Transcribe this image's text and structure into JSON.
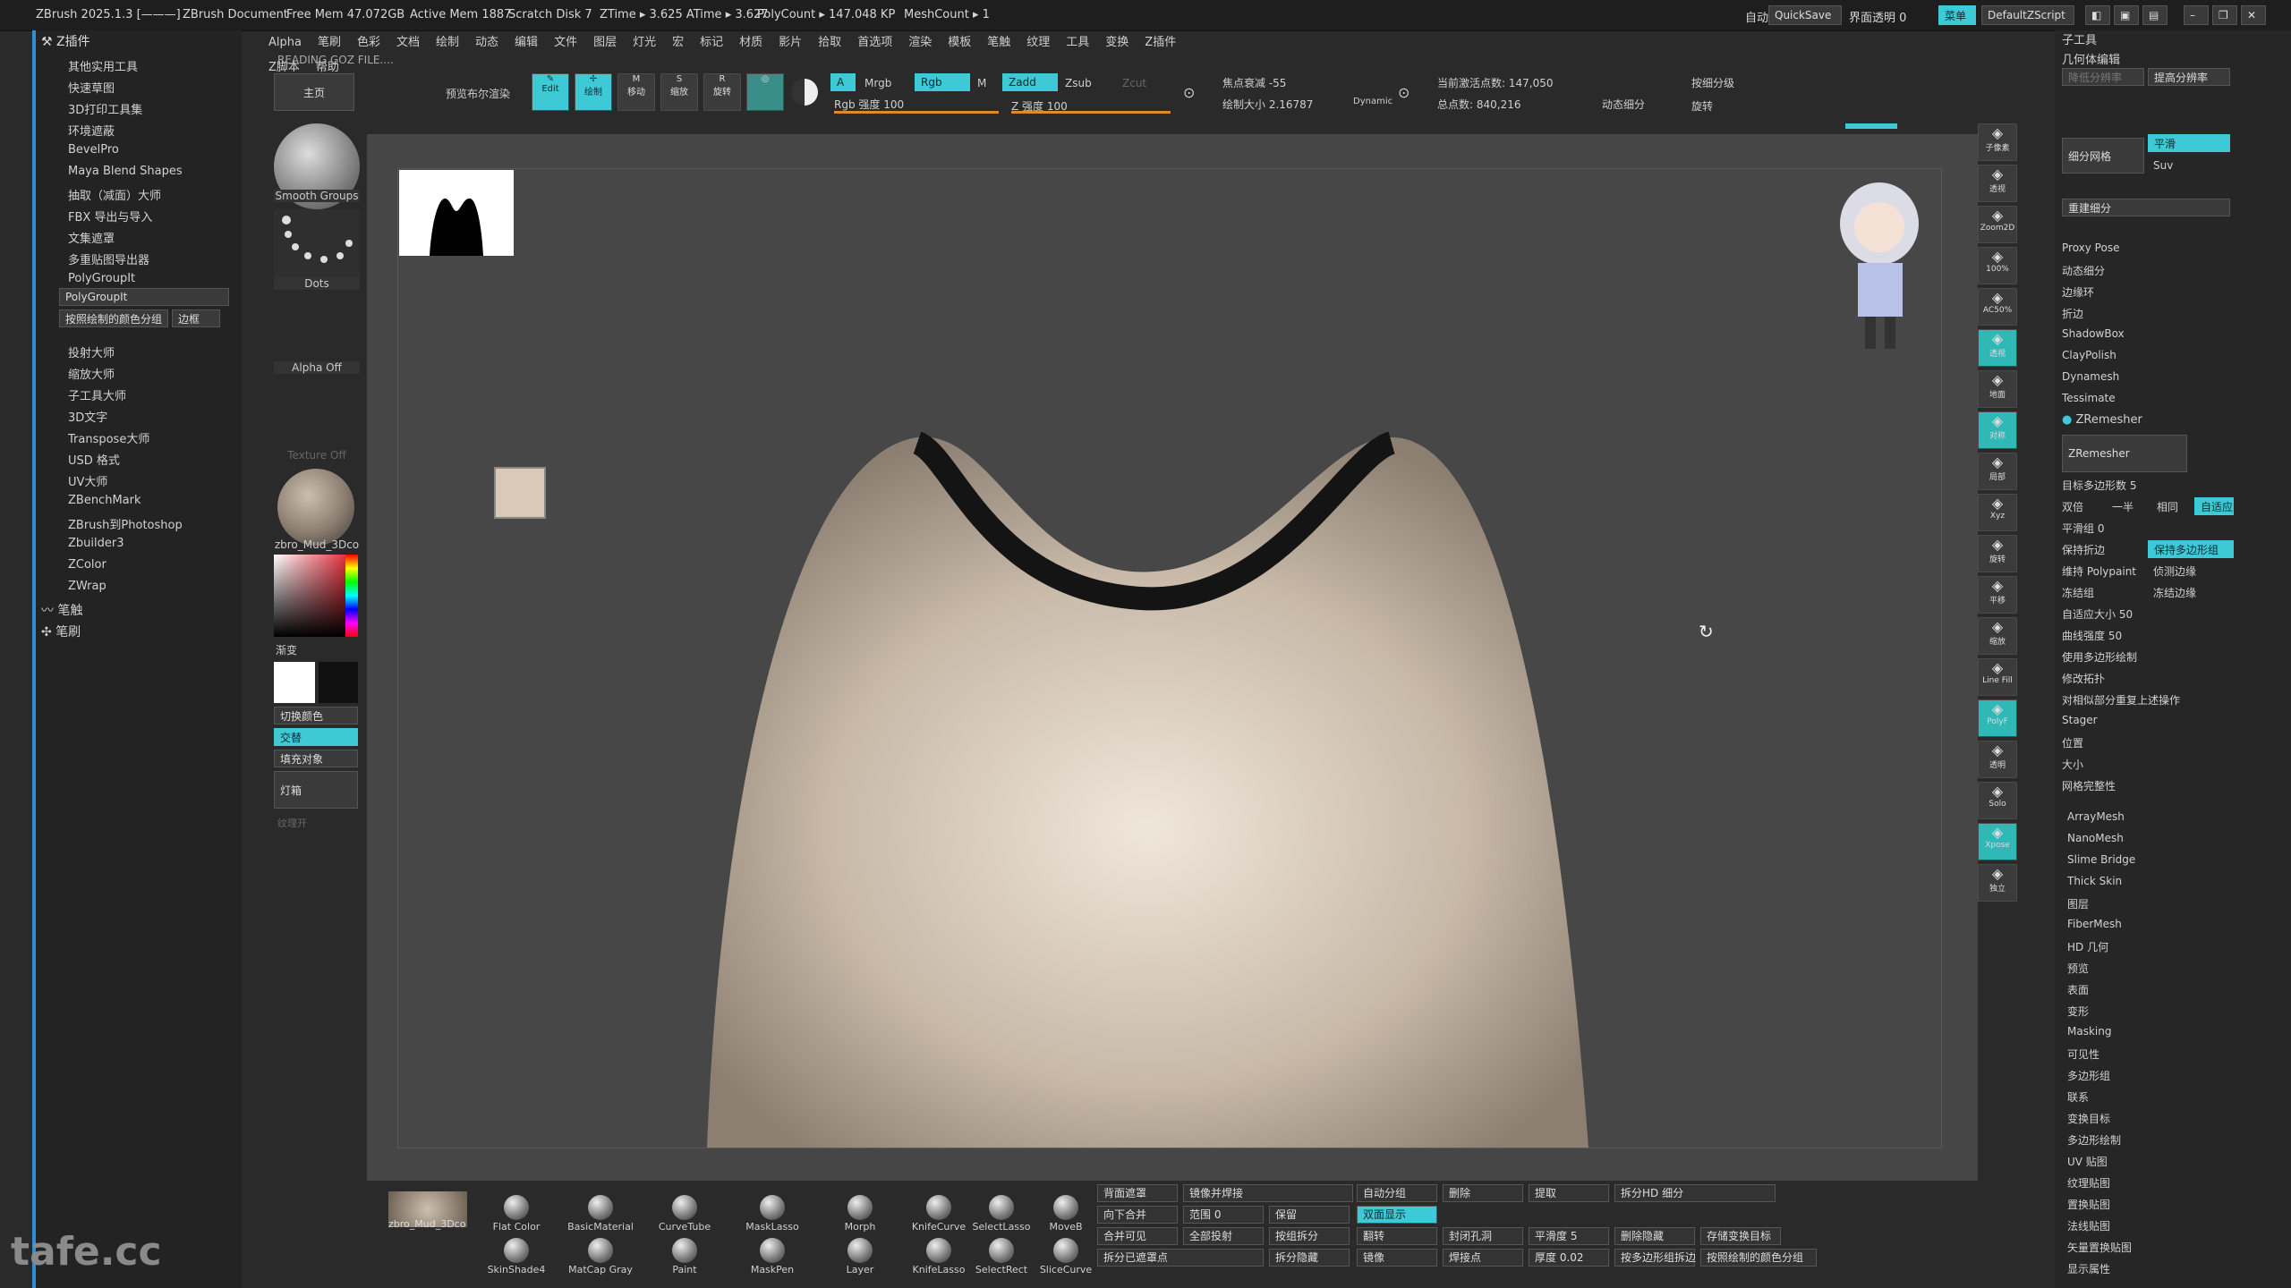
{
  "titlebar": {
    "app": "ZBrush 2025.1.3 [———]",
    "doc": "ZBrush Document",
    "free_mem": "Free Mem 47.072GB",
    "active_mem": "Active Mem 1887",
    "scratch": "Scratch Disk 7",
    "ztime": "ZTime ▸ 3.625 ATime ▸ 3.627",
    "polycount": "PolyCount ▸ 147.048 KP",
    "meshcount": "MeshCount ▸ 1",
    "auto": "自动",
    "quicksave": "QuickSave",
    "transparency": "界面透明 0",
    "menu_btn": "菜单",
    "script": "DefaultZScript"
  },
  "menubar": [
    "Alpha",
    "笔刷",
    "色彩",
    "文档",
    "绘制",
    "动态",
    "编辑",
    "文件",
    "图层",
    "灯光",
    "宏",
    "标记",
    "材质",
    "影片",
    "拾取",
    "首选项",
    "渲染",
    "模板",
    "笔触",
    "纹理",
    "工具",
    "变换",
    "Z插件",
    "Z脚本",
    "帮助"
  ],
  "left_panel": {
    "header": "Z插件",
    "items": [
      "其他实用工具",
      "快速草图",
      "3D打印工具集",
      "环境遮蔽",
      "BevelPro",
      "Maya Blend Shapes",
      "抽取（减面）大师",
      "FBX 导出与导入",
      "文集遮罩",
      "多重贴图导出器",
      "PolyGroupIt"
    ],
    "polygroupit_btn": "PolyGroupIt",
    "by_color_btn": "按照绘制的颜色分组",
    "edge_btn": "边框",
    "items2": [
      "投射大师",
      "缩放大师",
      "子工具大师",
      "3D文字",
      "Transpose大师",
      "USD 格式",
      "UV大师",
      "ZBenchMark",
      "ZBrush到Photoshop",
      "Zbuilder3",
      "ZColor",
      "ZWrap"
    ],
    "stroke": "笔触",
    "brush": "笔刷"
  },
  "shelf": {
    "status": "READING GOZ FILE....",
    "home": "主页",
    "preview_boolean": "预览布尔渲染",
    "edit": "Edit",
    "draw": "绘制",
    "move": "移动",
    "scale": "缩放",
    "rotate": "旋转",
    "a": "A",
    "mrgb": "Mrgb",
    "rgb": "Rgb",
    "m": "M",
    "zadd": "Zadd",
    "zsub": "Zsub",
    "zcut": "Zcut",
    "rgb_intensity": "Rgb 强度 100",
    "z_intensity": "Z 强度 100",
    "focal": "焦点衰减 -55",
    "draw_size": "绘制大小 2.16787",
    "dynamic": "Dynamic",
    "active_points": "当前激活点数: 147,050",
    "total_points": "总点数: 840,216",
    "dynamic_sub": "动态细分",
    "smooth_sub": "按细分级",
    "rotate_label": "旋转"
  },
  "left_tray": {
    "smooth_groups": "Smooth Groups",
    "dots": "Dots",
    "alpha_off": "Alpha Off",
    "texture_off": "Texture Off",
    "material": "zbro_Mud_3Dco",
    "gradient": "渐变",
    "switch_color": "切换颜色",
    "alternate": "交替",
    "fill_object": "填充对象",
    "lightbox": "灯箱",
    "tex_off": "纹理开"
  },
  "right_tray": [
    "子像素",
    "透视",
    "Zoom2D",
    "100%",
    "AC50%",
    "透视",
    "地面",
    "对称",
    "局部",
    "Xyz",
    "旋转",
    "平移",
    "缩放",
    "Line Fill",
    "PolyF",
    "透明",
    "Solo",
    "Xpose",
    "独立"
  ],
  "right_panel": {
    "header": "子工具",
    "section": "几何体编辑",
    "lower_res": "降低分辨率",
    "higher_res": "提高分辨率",
    "subdivide": "细分网格",
    "smooth": "平滑",
    "suv": "Suv",
    "reconstruct": "重建细分",
    "items": [
      "Proxy Pose",
      "动态细分",
      "边缘环",
      "折边",
      "ShadowBox",
      "ClayPolish",
      "Dynamesh",
      "Tessimate"
    ],
    "zremesher_head": "ZRemesher",
    "zremesher_btn": "ZRemesher",
    "target_count": "目标多边形数 5",
    "double": "双倍",
    "half": "一半",
    "same": "相同",
    "adapt": "自适应",
    "smooth_groups": "平滑组 0",
    "keep_creases": "保持折边",
    "keep_groups": "保持多边形组",
    "keep_polypaint": "维持 Polypaint",
    "detect_edges": "侦测边缘",
    "freeze": "冻结组",
    "freeze_border": "冻结边缘",
    "adaptive_size": "自适应大小 50",
    "curve_strength": "曲线强度 50",
    "use_polypaint": "使用多边形绘制",
    "modify_topo": "修改拓扑",
    "repeat": "对相似部分重复上述操作",
    "stager": "Stager",
    "position": "位置",
    "size": "大小",
    "mesh_integrity": "网格完整性",
    "subpalettes": [
      "ArrayMesh",
      "NanoMesh",
      "Slime Bridge",
      "Thick Skin",
      "图层",
      "FiberMesh",
      "HD 几何",
      "预览",
      "表面",
      "变形",
      "Masking",
      "可见性",
      "多边形组",
      "联系",
      "变换目标",
      "多边形绘制",
      "UV 贴图",
      "纹理贴图",
      "置换贴图",
      "法线贴图",
      "矢量置换贴图",
      "显示属性"
    ]
  },
  "bottom_shelf": {
    "material": "zbro_Mud_3Dco",
    "brushes_row1": [
      "Flat Color",
      "BasicMaterial",
      "CurveTube",
      "MaskLasso",
      "Morph",
      "KnifeCurve",
      "SelectLasso",
      "MoveB"
    ],
    "brushes_row2": [
      "SkinShade4",
      "MatCap Gray",
      "Paint",
      "MaskPen",
      "Layer",
      "KnifeLasso",
      "SelectRect",
      "SliceCurve"
    ],
    "backface": "背面遮罩",
    "mirror_weld": "镜像并焊接",
    "auto_group": "自动分组",
    "delete": "删除",
    "extract": "提取",
    "split_hd": "拆分HD 细分",
    "merge_down": "向下合并",
    "range": "范围 0",
    "keep": "保留",
    "double_display": "双面显示",
    "merge_visible": "合并可见",
    "project_all": "全部投射",
    "group_split": "按组拆分",
    "flip": "翻转",
    "close_holes": "封闭孔洞",
    "smooth_5": "平滑度 5",
    "del_hidden": "删除隐藏",
    "store_morph": "存储变换目标",
    "split_masked": "拆分已遮罩点",
    "split_unmasked": "拆分隐藏",
    "mirror": "镜像",
    "weld_points": "焊接点",
    "thickness": "厚度 0.02",
    "group_by_poly": "按多边形组拆边",
    "group_by_color": "按照绘制的颜色分组"
  },
  "watermark": "tafe.cc"
}
